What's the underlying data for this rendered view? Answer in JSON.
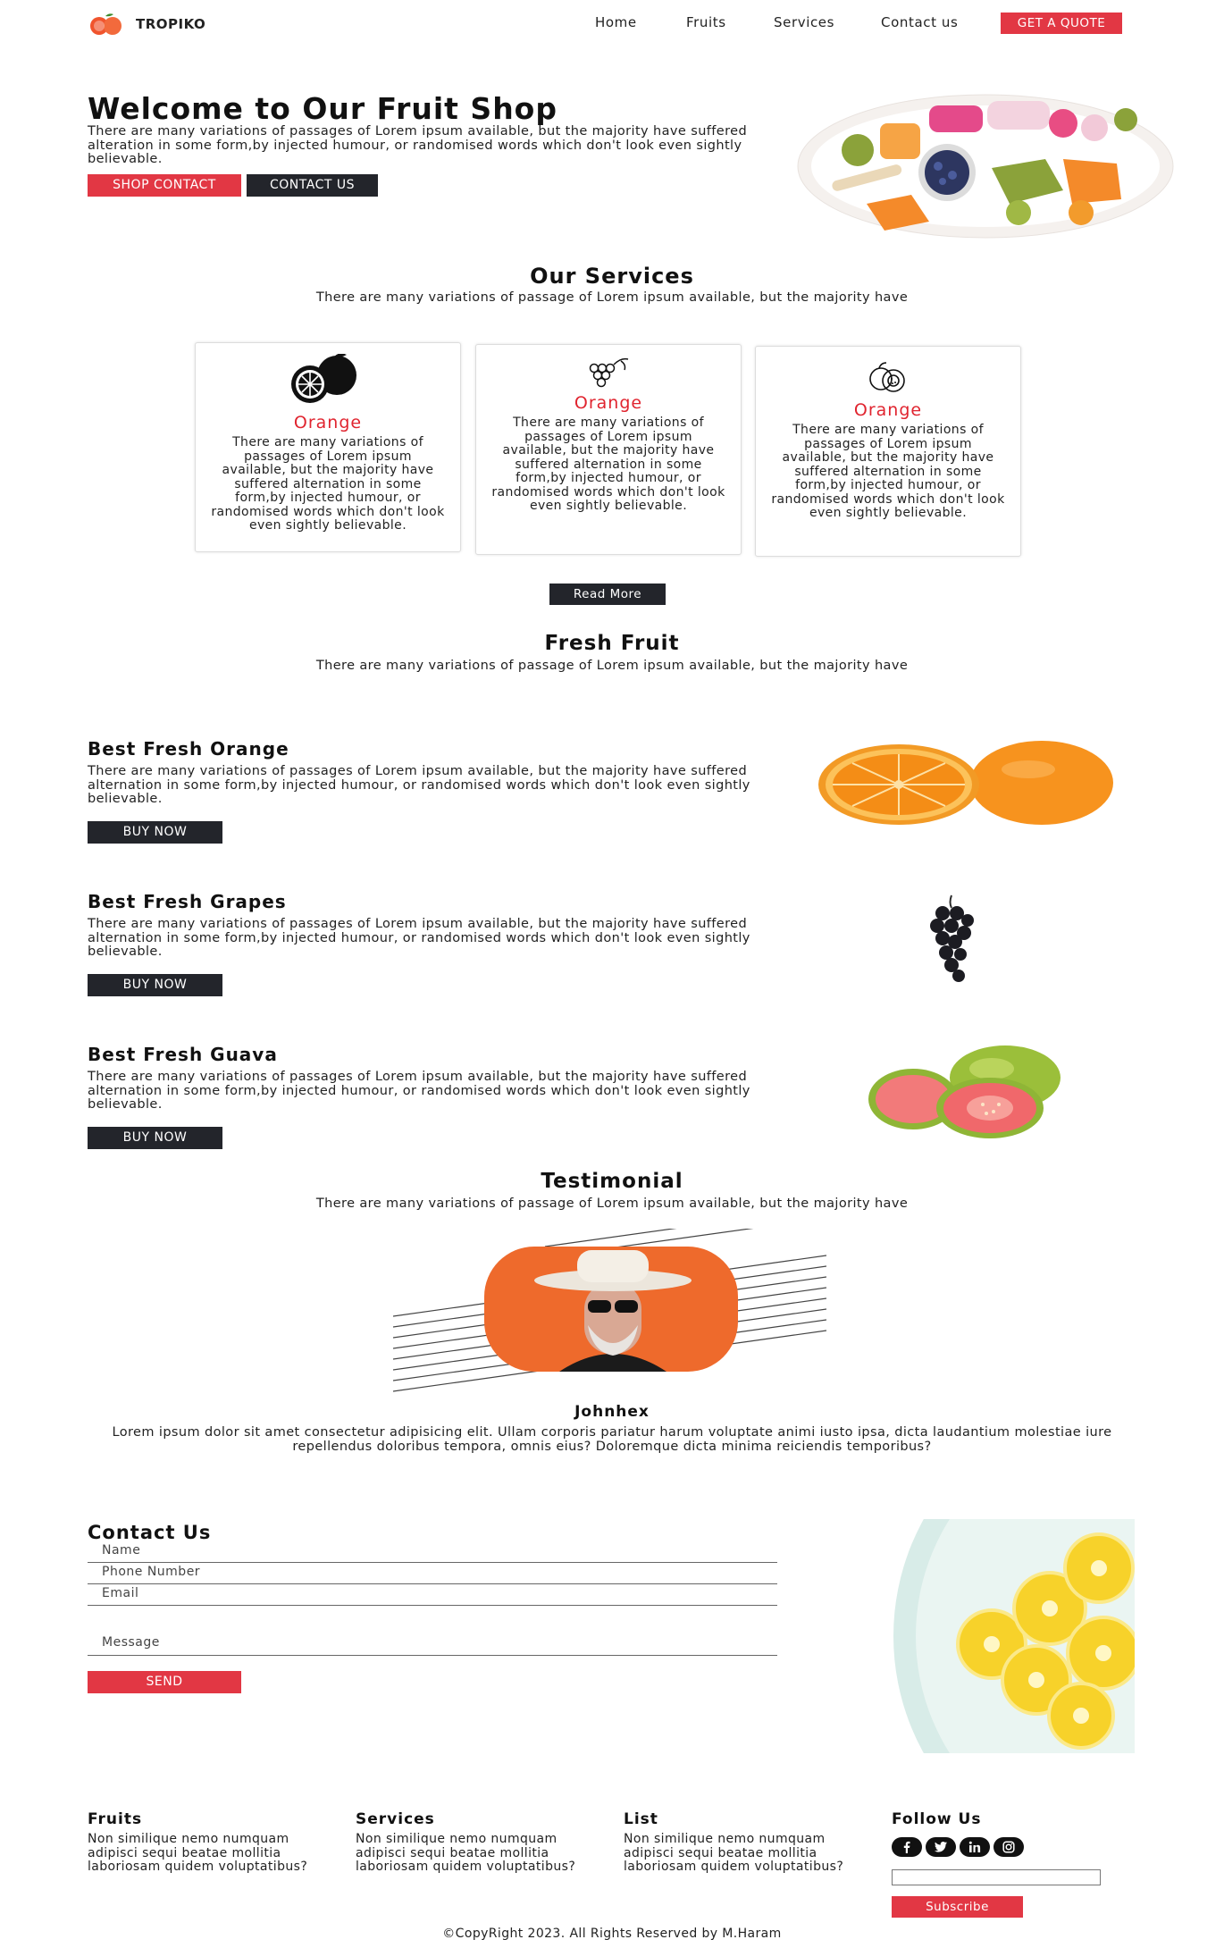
{
  "brand": {
    "name": "TROPIKO"
  },
  "nav": {
    "items": [
      "Home",
      "Fruits",
      "Services",
      "Contact us"
    ],
    "cta": "GET A QUOTE"
  },
  "hero": {
    "title": "Welcome to Our Fruit Shop",
    "text": "There are many variations of passages of Lorem ipsum available, but the majority have suffered alteration in some form,by injected humour, or randomised words which don't look even sightly believable.",
    "btn_primary": "SHOP CONTACT",
    "btn_secondary": "CONTACT US"
  },
  "services": {
    "title": "Our Services",
    "subtitle": "There are many variations of passage of Lorem ipsum available, but the majority have",
    "cards": [
      {
        "icon": "orange-icon",
        "title": "Orange",
        "text": "There are many variations of passages of Lorem ipsum available, but the majority have suffered alternation in some form,by injected humour, or randomised words which don't look even sightly believable."
      },
      {
        "icon": "grapes-icon",
        "title": "Orange",
        "text": "There are many variations of passages of Lorem ipsum available, but the majority have suffered alternation in some form,by injected humour, or randomised words which don't look even sightly believable."
      },
      {
        "icon": "guava-icon",
        "title": "Orange",
        "text": "There are many variations of passages of Lorem ipsum available, but the majority have suffered alternation in some form,by injected humour, or randomised words which don't look even sightly believable."
      }
    ],
    "read_more": "Read More"
  },
  "fresh": {
    "title": "Fresh Fruit",
    "subtitle": "There are many variations of passage of Lorem ipsum available, but the majority have",
    "items": [
      {
        "title": "Best Fresh Orange",
        "text": "There are many variations of passages of Lorem ipsum available, but the majority have suffered alternation in some form,by injected humour, or randomised words which don't look even sightly believable.",
        "button": "BUY NOW"
      },
      {
        "title": "Best Fresh Grapes",
        "text": "There are many variations of passages of Lorem ipsum available, but the majority have suffered alternation in some form,by injected humour, or randomised words which don't look even sightly believable.",
        "button": "BUY NOW"
      },
      {
        "title": "Best Fresh Guava",
        "text": "There are many variations of passages of Lorem ipsum available, but the majority have suffered alternation in some form,by injected humour, or randomised words which don't look even sightly believable.",
        "button": "BUY NOW"
      }
    ]
  },
  "testimonial": {
    "title": "Testimonial",
    "subtitle": "There are many variations of passage of Lorem ipsum available, but the majority have",
    "name": "Johnhex",
    "quote": "Lorem ipsum dolor sit amet consectetur adipisicing elit. Ullam corporis pariatur harum voluptate animi iusto ipsa, dicta laudantium molestiae iure repellendus doloribus tempora, omnis eius? Doloremque dicta minima reiciendis temporibus?"
  },
  "contact": {
    "title": "Contact Us",
    "name_placeholder": "Name",
    "phone_placeholder": "Phone Number",
    "email_placeholder": "Email",
    "message_placeholder": "Message",
    "send": "SEND"
  },
  "footer": {
    "cols": [
      {
        "title": "Fruits",
        "text": "Non similique nemo numquam adipisci sequi beatae mollitia laboriosam quidem voluptatibus?"
      },
      {
        "title": "Services",
        "text": "Non similique nemo numquam adipisci sequi beatae mollitia laboriosam quidem voluptatibus?"
      },
      {
        "title": "List",
        "text": "Non similique nemo numquam adipisci sequi beatae mollitia laboriosam quidem voluptatibus?"
      }
    ],
    "follow_title": "Follow Us",
    "social_icons": [
      "facebook-icon",
      "twitter-icon",
      "linkedin-icon",
      "instagram-icon"
    ],
    "subscribe": "Subscribe",
    "copyright": "©CopyRight 2023. All Rights Reserved by M.Haram"
  },
  "colors": {
    "accent": "#e23744",
    "dark": "#23252b",
    "card_title": "#e0242f"
  }
}
